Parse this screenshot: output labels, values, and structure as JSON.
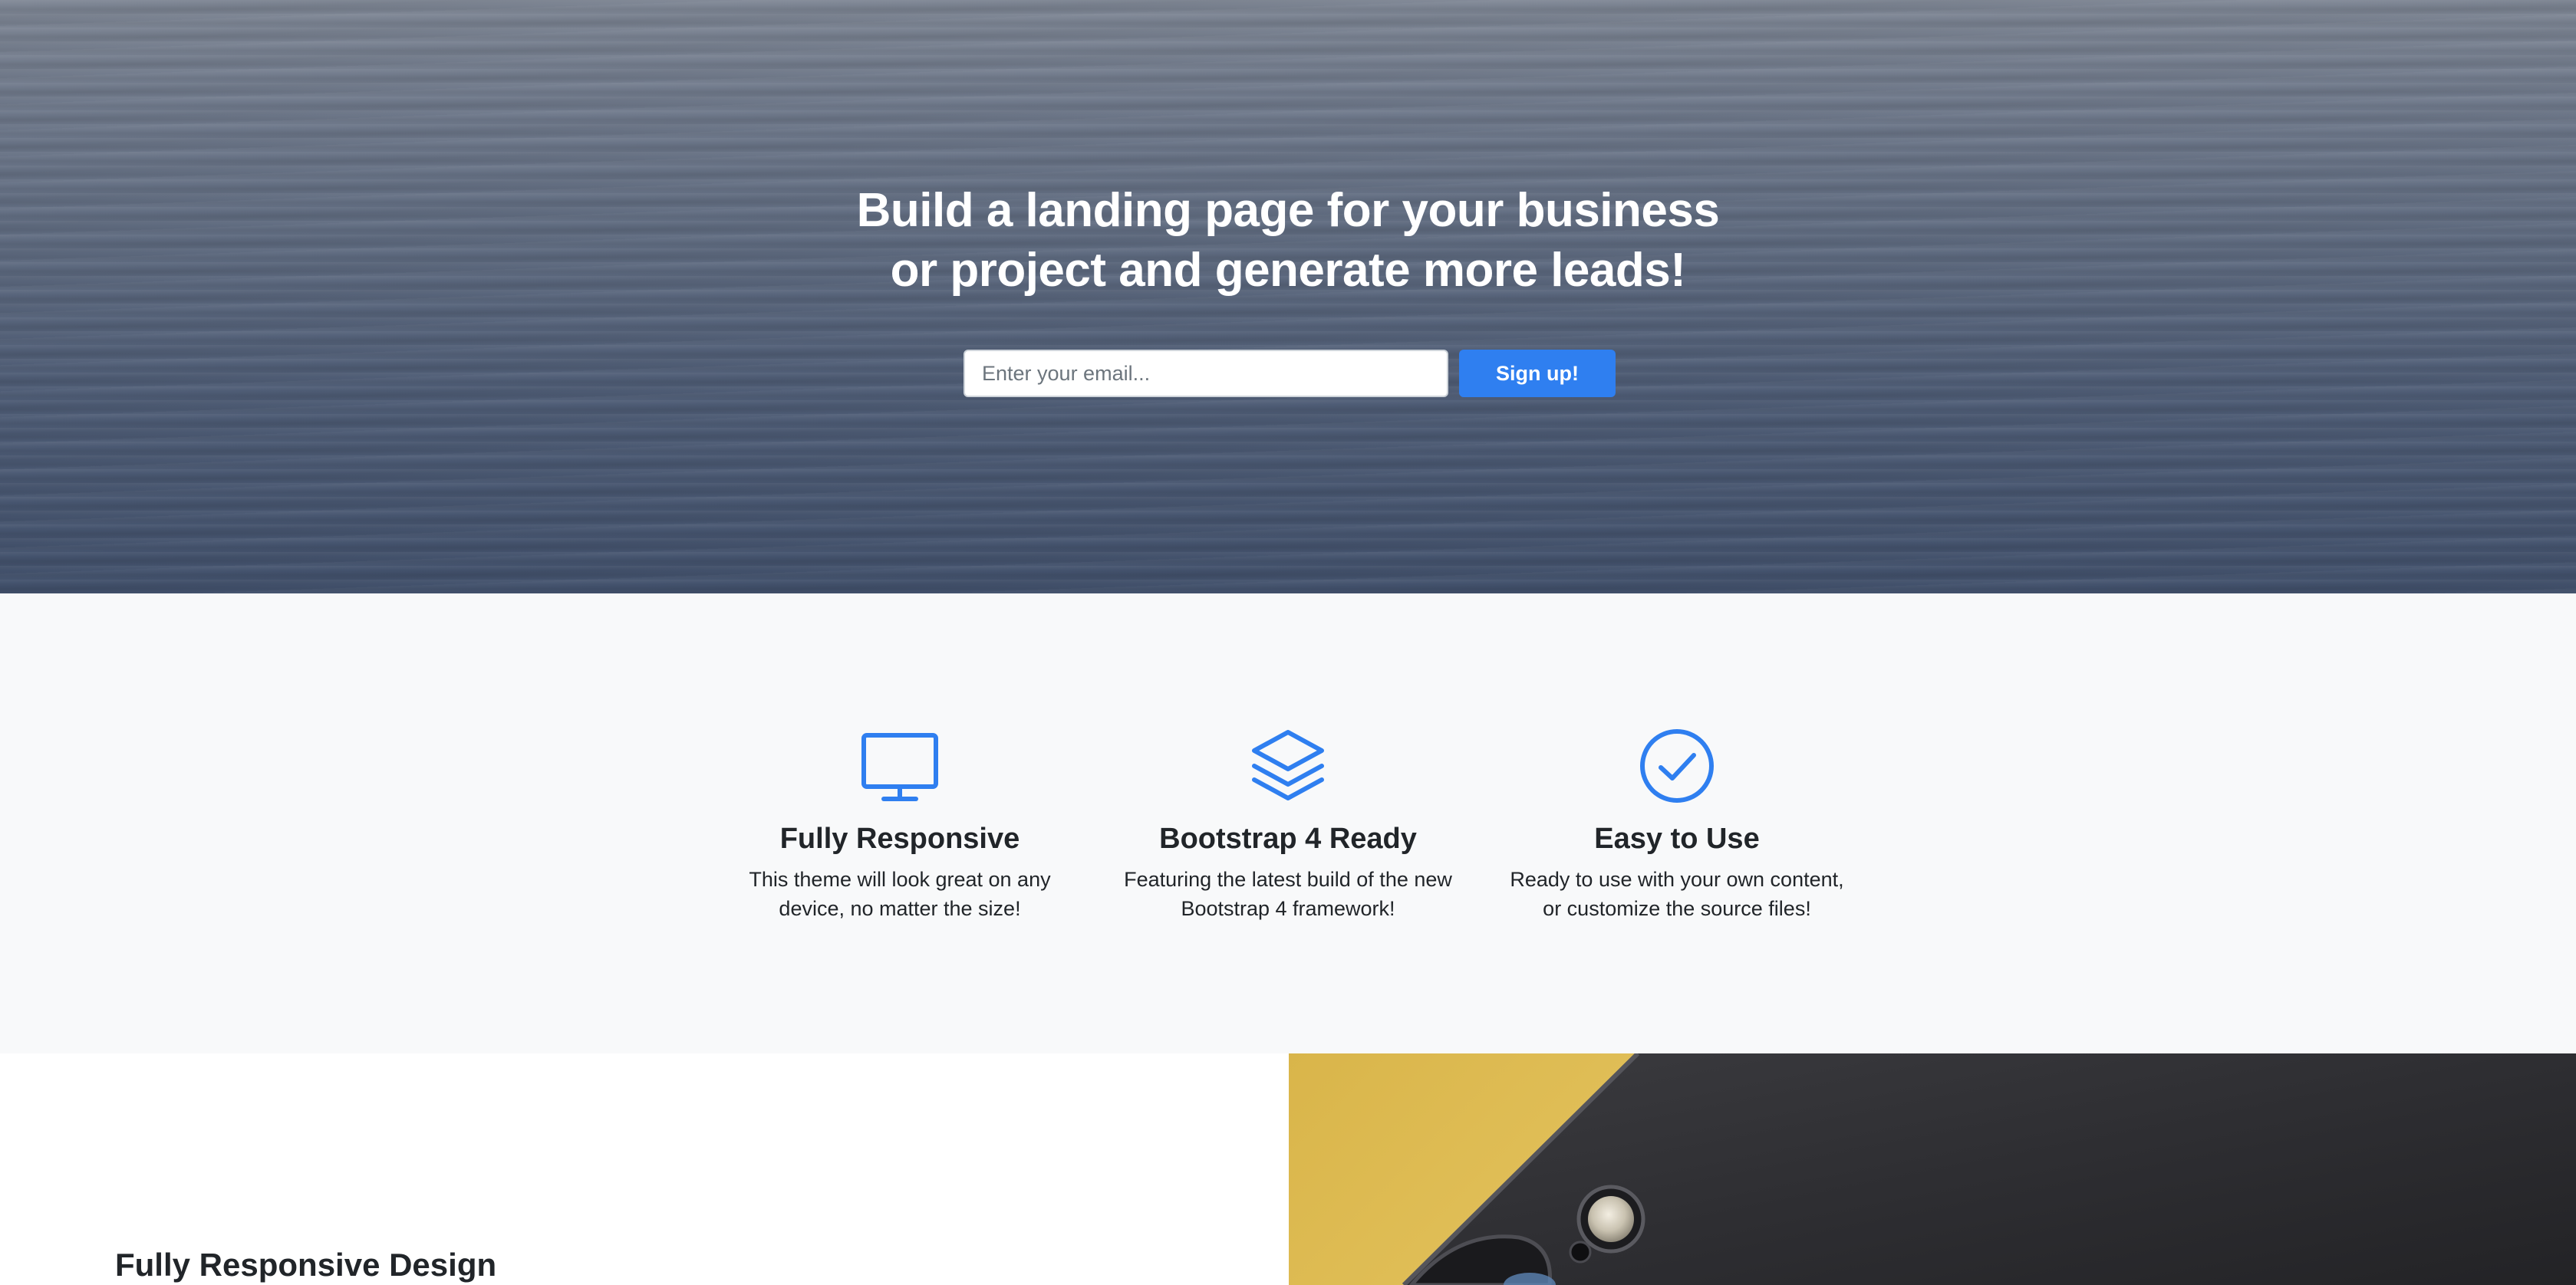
{
  "hero": {
    "title_line1": "Build a landing page for your business",
    "title_line2": "or project and generate more leads!",
    "email_placeholder": "Enter your email...",
    "signup_label": "Sign up!"
  },
  "features": [
    {
      "icon": "desktop-monitor-icon",
      "title": "Fully Responsive",
      "text_line1": "This theme will look great on any",
      "text_line2": "device, no matter the size!"
    },
    {
      "icon": "layers-icon",
      "title": "Bootstrap 4 Ready",
      "text_line1": "Featuring the latest build of the new",
      "text_line2": "Bootstrap 4 framework!"
    },
    {
      "icon": "check-circle-icon",
      "title": "Easy to Use",
      "text_line1": "Ready to use with your own content,",
      "text_line2": "or customize the source files!"
    }
  ],
  "showcase": {
    "heading": "Fully Responsive Design"
  },
  "colors": {
    "accent": "#2f7ff0",
    "icon": "#2f7ff0",
    "features_background": "#f8f9fa",
    "text": "#212529"
  }
}
